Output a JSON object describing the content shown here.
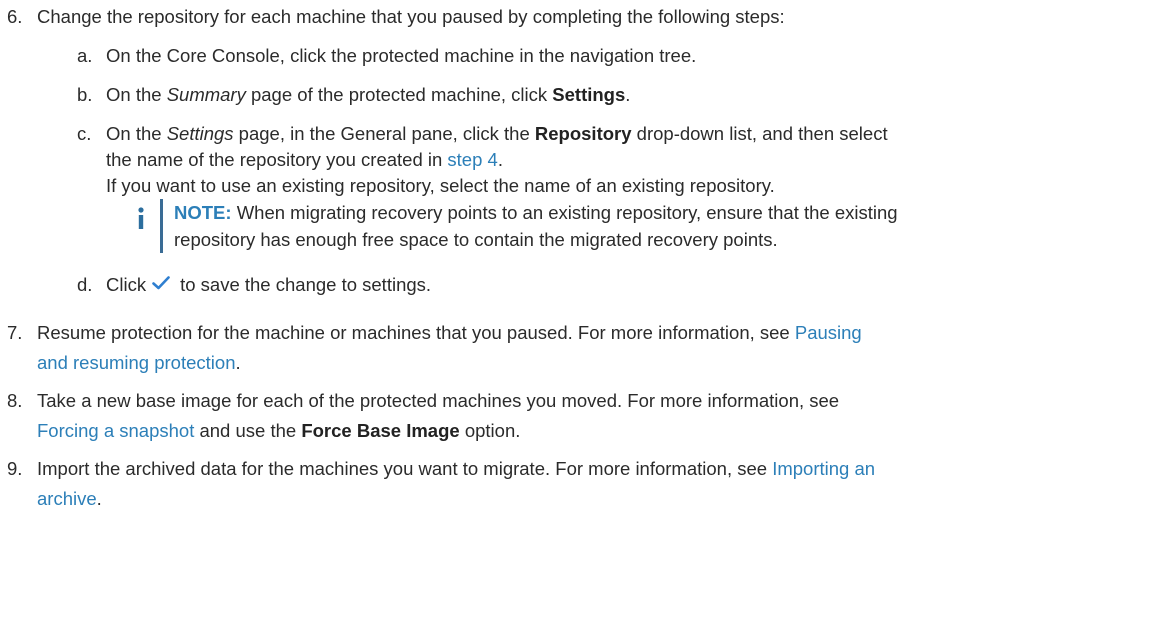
{
  "steps": [
    {
      "number": "6.",
      "text": "Change the repository for each machine that you paused by completing the following steps:"
    },
    {
      "number": "7.",
      "text_before": "Resume protection for the machine or machines that you paused. For more information, see ",
      "link": "Pausing",
      "text_line2_link": "and resuming protection",
      "text_after": "."
    },
    {
      "number": "8.",
      "text_line1": "Take a new base image for each of the protected machines you moved. For more information, see",
      "link": "Forcing a snapshot",
      "text_mid": " and use the ",
      "bold": "Force Base Image",
      "text_after": " option."
    },
    {
      "number": "9.",
      "text_before": "Import the archived data for the machines you want to migrate. For more information, see ",
      "link": "Importing an",
      "text_line2_link": "archive",
      "text_after": "."
    }
  ],
  "substeps": {
    "a": {
      "letter": "a.",
      "text": "On the Core Console, click the protected machine in the navigation tree."
    },
    "b": {
      "letter": "b.",
      "t1": "On the ",
      "em": "Summary",
      "t2": " page of the protected machine, click ",
      "bold": "Settings",
      "t3": "."
    },
    "c": {
      "letter": "c.",
      "t1": "On the ",
      "em": "Settings",
      "t2": " page, in the General pane, click the ",
      "bold": "Repository",
      "t3": " drop-down list, and then select",
      "line2": "the name of the repository you created in ",
      "link": "step 4",
      "t4": ".",
      "line3": "If you want to use an existing repository, select the name of an existing repository."
    },
    "d": {
      "letter": "d.",
      "t1": "Click",
      "t2": "to save the change to settings."
    }
  },
  "note": {
    "label": "NOTE:",
    "line1": " When migrating recovery points to an existing repository, ensure that the existing",
    "line2": "repository has enough free space to contain the migrated recovery points."
  },
  "colors": {
    "link": "#2c7fb8",
    "note_bar": "#3a6c95",
    "check_icon": "#2f7fd0"
  }
}
